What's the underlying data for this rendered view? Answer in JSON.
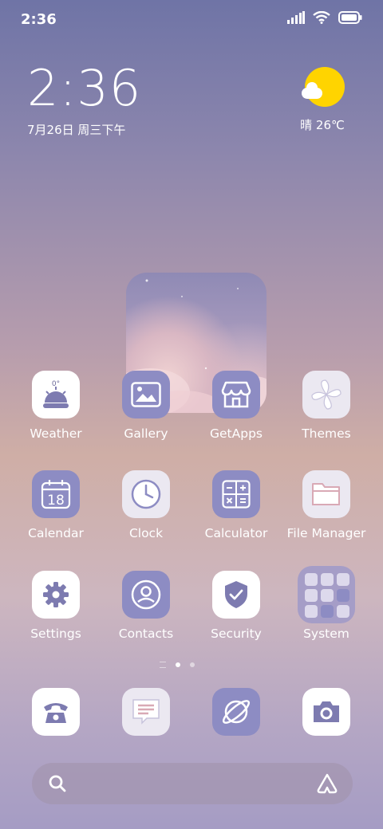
{
  "status_bar": {
    "time": "2:36"
  },
  "clock_widget": {
    "time": "2:36",
    "date": "7月26日 周三下午"
  },
  "weather_widget": {
    "text": "晴 26℃",
    "icon": "sunny-cloud-icon"
  },
  "apps": [
    {
      "label": "Weather",
      "icon": "weather-icon"
    },
    {
      "label": "Gallery",
      "icon": "gallery-icon"
    },
    {
      "label": "GetApps",
      "icon": "store-icon"
    },
    {
      "label": "Themes",
      "icon": "themes-icon"
    },
    {
      "label": "Calendar",
      "icon": "calendar-icon",
      "day": "18"
    },
    {
      "label": "Clock",
      "icon": "clock-icon"
    },
    {
      "label": "Calculator",
      "icon": "calculator-icon"
    },
    {
      "label": "File Manager",
      "icon": "folder-icon"
    },
    {
      "label": "Settings",
      "icon": "gear-icon"
    },
    {
      "label": "Contacts",
      "icon": "contacts-icon"
    },
    {
      "label": "Security",
      "icon": "shield-icon"
    },
    {
      "label": "System",
      "icon": "folder-grid-icon"
    }
  ],
  "dock": [
    {
      "icon": "phone-icon"
    },
    {
      "icon": "messages-icon"
    },
    {
      "icon": "browser-icon"
    },
    {
      "icon": "camera-icon"
    }
  ],
  "page_indicator": {
    "pages": 2,
    "active": 1
  },
  "colors": {
    "accent_purple": "#8d8cc3",
    "sun": "#ffd400"
  }
}
